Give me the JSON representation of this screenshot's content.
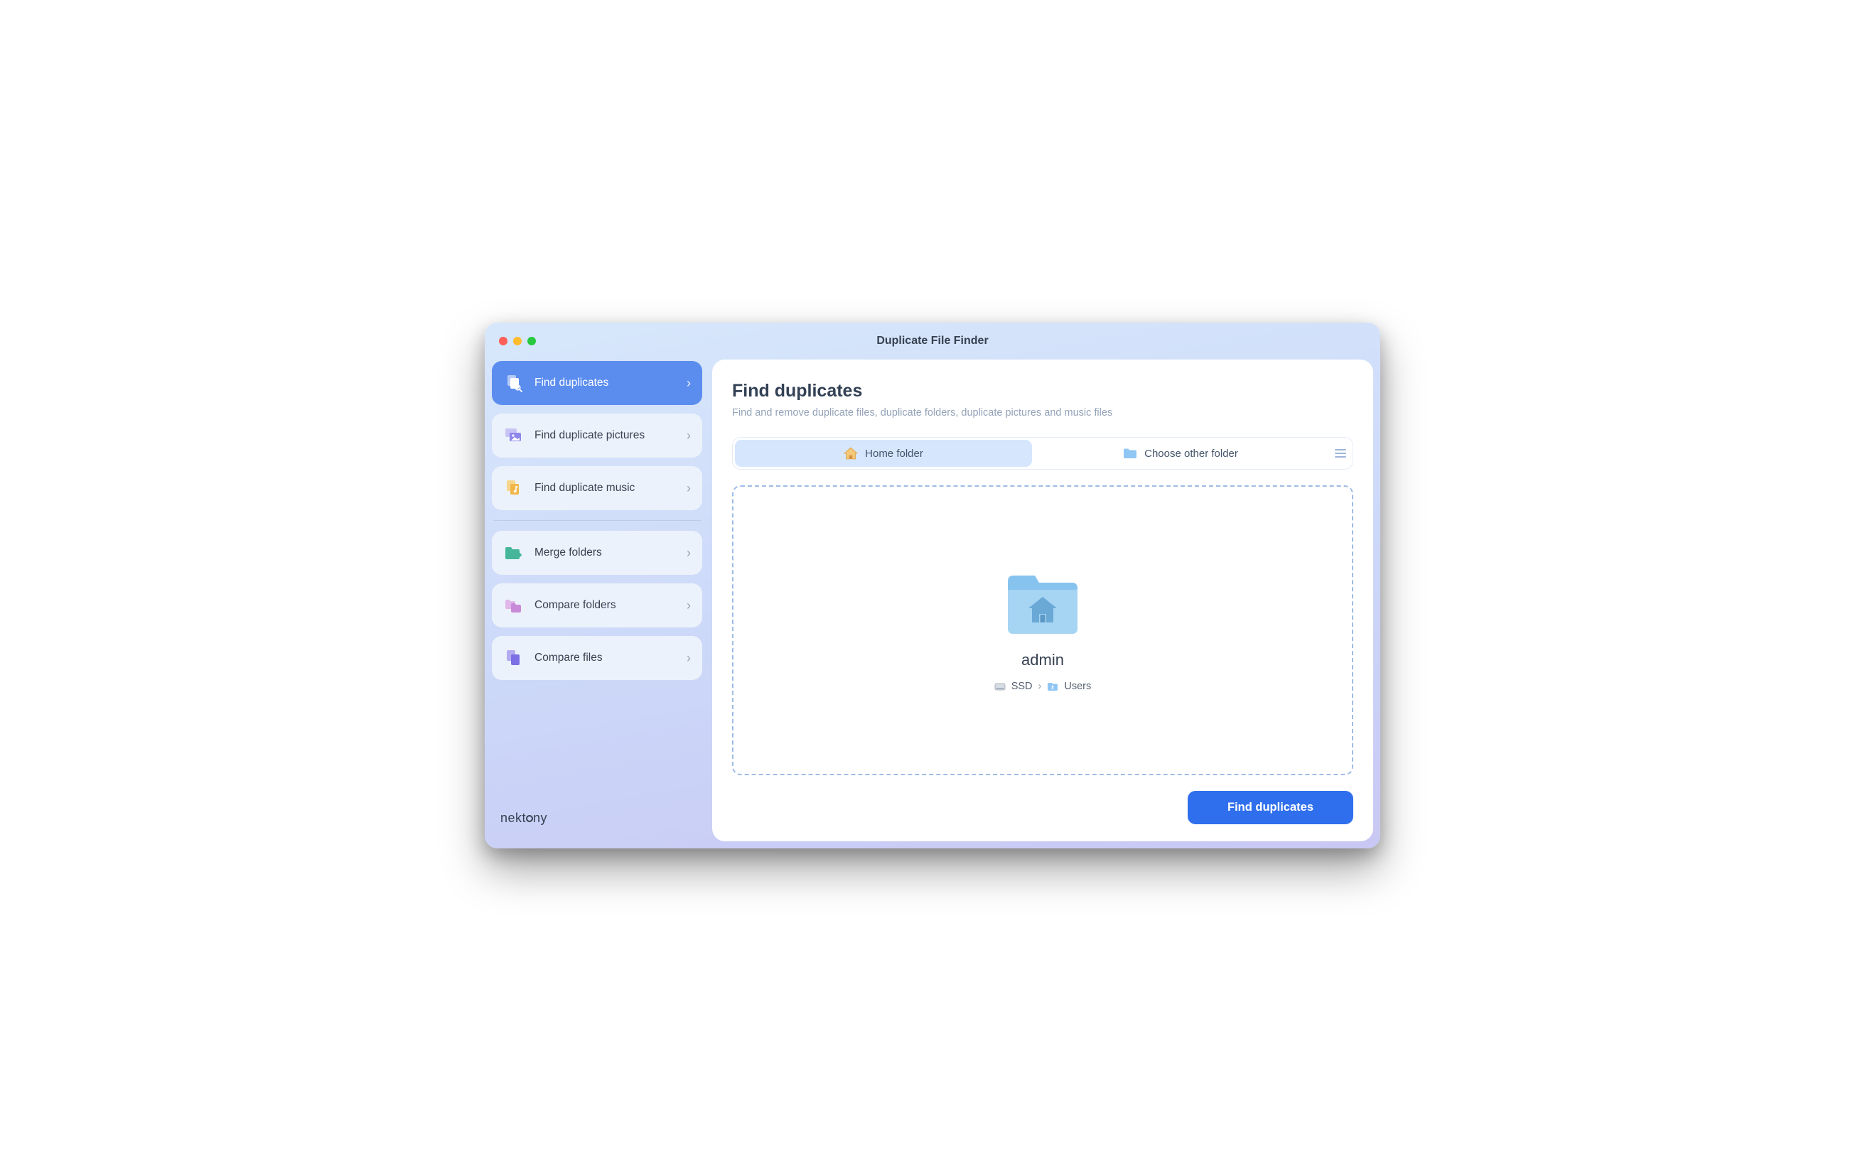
{
  "window": {
    "title": "Duplicate File Finder"
  },
  "sidebar": {
    "groups": [
      [
        {
          "label": "Find duplicates"
        },
        {
          "label": "Find duplicate pictures"
        },
        {
          "label": "Find duplicate music"
        }
      ],
      [
        {
          "label": "Merge folders"
        },
        {
          "label": "Compare folders"
        },
        {
          "label": "Compare files"
        }
      ]
    ]
  },
  "brand": "nektony",
  "main": {
    "title": "Find duplicates",
    "subtitle": "Find and remove duplicate files, duplicate folders, duplicate pictures and music files",
    "tabs": {
      "home": "Home folder",
      "other": "Choose other folder"
    },
    "selected_folder": {
      "name": "admin",
      "path": [
        "SSD",
        "Users"
      ]
    },
    "primary_action": "Find duplicates"
  }
}
